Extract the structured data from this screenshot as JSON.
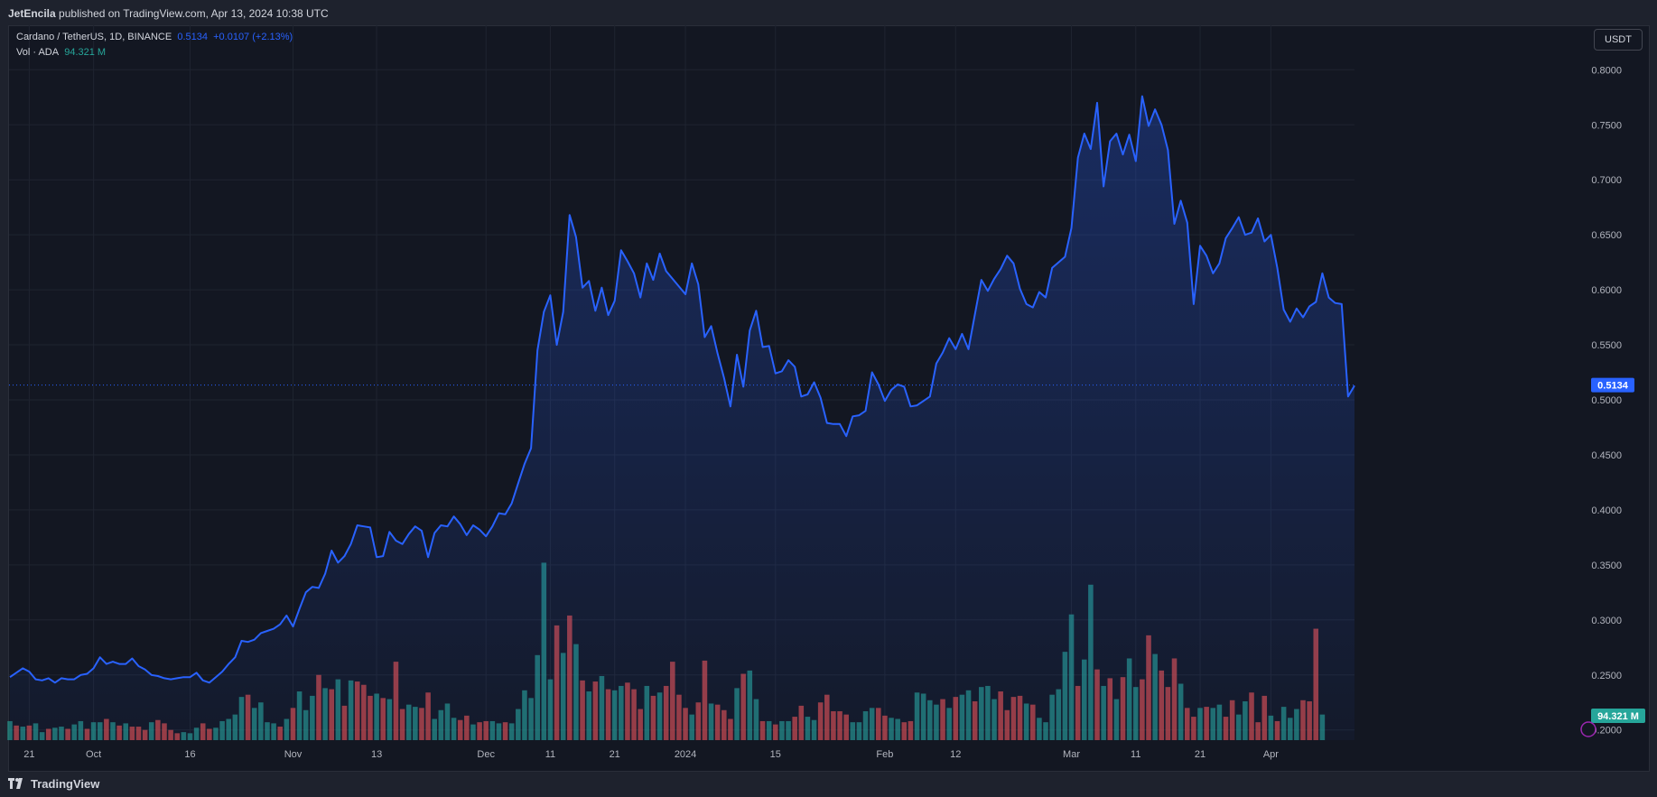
{
  "header": {
    "publisher": "JetEncila",
    "published_text": "published on TradingView.com, Apr 13, 2024 10:38 UTC"
  },
  "legend": {
    "symbol": "Cardano / TetherUS, 1D, BINANCE",
    "last": "0.5134",
    "change": "+0.0107 (+2.13%)",
    "vol_label": "Vol · ADA",
    "vol_value": "94.321 M"
  },
  "currency_button": "USDT",
  "footer": {
    "logo_text": "TradingView"
  },
  "colors": {
    "line": "#2962ff",
    "up_volume": "#26a69a",
    "down_volume": "#ef5350",
    "background": "#131722",
    "grid": "#1f2430"
  },
  "chart_data": {
    "type": "area",
    "title": "Cardano / TetherUS, 1D, BINANCE",
    "ylim": [
      0.19,
      0.82
    ],
    "y_ticks": [
      "0.8000",
      "0.7500",
      "0.7000",
      "0.6500",
      "0.6000",
      "0.5500",
      "0.5000",
      "0.4500",
      "0.4000",
      "0.3500",
      "0.3000",
      "0.2500",
      "0.2000"
    ],
    "x_ticks": [
      {
        "label": "21",
        "index": 3
      },
      {
        "label": "Oct",
        "index": 13
      },
      {
        "label": "16",
        "index": 28
      },
      {
        "label": "Nov",
        "index": 44
      },
      {
        "label": "13",
        "index": 57
      },
      {
        "label": "Dec",
        "index": 74
      },
      {
        "label": "11",
        "index": 84
      },
      {
        "label": "21",
        "index": 94
      },
      {
        "label": "2024",
        "index": 105
      },
      {
        "label": "15",
        "index": 119
      },
      {
        "label": "Feb",
        "index": 136
      },
      {
        "label": "12",
        "index": 147
      },
      {
        "label": "Mar",
        "index": 165
      },
      {
        "label": "11",
        "index": 175
      },
      {
        "label": "21",
        "index": 185
      },
      {
        "label": "Apr",
        "index": 196
      }
    ],
    "last_price_label": "0.5134",
    "last_volume_label": "94.321 M",
    "price": [
      0.248,
      0.252,
      0.256,
      0.253,
      0.246,
      0.245,
      0.247,
      0.243,
      0.247,
      0.246,
      0.246,
      0.25,
      0.251,
      0.256,
      0.266,
      0.26,
      0.262,
      0.26,
      0.26,
      0.265,
      0.258,
      0.255,
      0.25,
      0.249,
      0.247,
      0.246,
      0.247,
      0.248,
      0.248,
      0.252,
      0.245,
      0.243,
      0.248,
      0.253,
      0.26,
      0.266,
      0.281,
      0.28,
      0.282,
      0.288,
      0.29,
      0.292,
      0.296,
      0.304,
      0.294,
      0.31,
      0.325,
      0.33,
      0.329,
      0.342,
      0.363,
      0.352,
      0.358,
      0.369,
      0.386,
      0.385,
      0.384,
      0.357,
      0.358,
      0.38,
      0.372,
      0.369,
      0.378,
      0.385,
      0.381,
      0.357,
      0.379,
      0.386,
      0.385,
      0.394,
      0.387,
      0.377,
      0.386,
      0.382,
      0.376,
      0.385,
      0.397,
      0.396,
      0.406,
      0.424,
      0.442,
      0.456,
      0.545,
      0.58,
      0.595,
      0.55,
      0.58,
      0.668,
      0.648,
      0.602,
      0.608,
      0.581,
      0.602,
      0.577,
      0.59,
      0.636,
      0.626,
      0.615,
      0.593,
      0.624,
      0.609,
      0.633,
      0.617,
      0.61,
      0.603,
      0.596,
      0.624,
      0.605,
      0.557,
      0.567,
      0.542,
      0.52,
      0.494,
      0.541,
      0.512,
      0.563,
      0.581,
      0.548,
      0.549,
      0.524,
      0.526,
      0.536,
      0.53,
      0.503,
      0.505,
      0.516,
      0.502,
      0.479,
      0.478,
      0.478,
      0.467,
      0.485,
      0.486,
      0.49,
      0.525,
      0.514,
      0.499,
      0.509,
      0.514,
      0.512,
      0.494,
      0.495,
      0.499,
      0.503,
      0.533,
      0.543,
      0.556,
      0.546,
      0.56,
      0.546,
      0.578,
      0.609,
      0.599,
      0.61,
      0.619,
      0.631,
      0.624,
      0.601,
      0.587,
      0.584,
      0.598,
      0.593,
      0.62,
      0.625,
      0.63,
      0.656,
      0.72,
      0.742,
      0.728,
      0.77,
      0.694,
      0.735,
      0.742,
      0.723,
      0.741,
      0.717,
      0.776,
      0.749,
      0.764,
      0.75,
      0.727,
      0.66,
      0.681,
      0.661,
      0.587,
      0.64,
      0.631,
      0.615,
      0.624,
      0.647,
      0.656,
      0.666,
      0.65,
      0.652,
      0.665,
      0.644,
      0.65,
      0.62,
      0.582,
      0.571,
      0.583,
      0.575,
      0.585,
      0.589,
      0.615,
      0.593,
      0.588,
      0.587,
      0.503,
      0.513
    ],
    "volume": [
      0.208,
      0.204,
      0.203,
      0.204,
      0.206,
      0.198,
      0.201,
      0.202,
      0.203,
      0.201,
      0.205,
      0.208,
      0.201,
      0.207,
      0.207,
      0.21,
      0.207,
      0.204,
      0.206,
      0.203,
      0.203,
      0.2,
      0.207,
      0.209,
      0.206,
      0.2,
      0.197,
      0.198,
      0.197,
      0.202,
      0.206,
      0.201,
      0.202,
      0.208,
      0.21,
      0.214,
      0.23,
      0.232,
      0.22,
      0.225,
      0.207,
      0.206,
      0.203,
      0.21,
      0.22,
      0.235,
      0.218,
      0.231,
      0.25,
      0.238,
      0.237,
      0.246,
      0.222,
      0.245,
      0.244,
      0.241,
      0.231,
      0.233,
      0.229,
      0.228,
      0.262,
      0.219,
      0.223,
      0.221,
      0.22,
      0.234,
      0.21,
      0.218,
      0.224,
      0.211,
      0.209,
      0.213,
      0.205,
      0.207,
      0.208,
      0.208,
      0.206,
      0.207,
      0.206,
      0.219,
      0.236,
      0.229,
      0.268,
      0.352,
      0.246,
      0.295,
      0.27,
      0.304,
      0.278,
      0.245,
      0.235,
      0.244,
      0.249,
      0.237,
      0.236,
      0.24,
      0.243,
      0.237,
      0.219,
      0.24,
      0.231,
      0.234,
      0.24,
      0.262,
      0.232,
      0.22,
      0.214,
      0.225,
      0.263,
      0.224,
      0.223,
      0.218,
      0.21,
      0.238,
      0.251,
      0.254,
      0.228,
      0.208,
      0.208,
      0.205,
      0.208,
      0.208,
      0.212,
      0.222,
      0.212,
      0.209,
      0.225,
      0.232,
      0.217,
      0.217,
      0.214,
      0.207,
      0.207,
      0.217,
      0.22,
      0.22,
      0.213,
      0.211,
      0.21,
      0.207,
      0.208,
      0.234,
      0.233,
      0.227,
      0.223,
      0.228,
      0.22,
      0.23,
      0.232,
      0.236,
      0.226,
      0.239,
      0.24,
      0.228,
      0.235,
      0.218,
      0.23,
      0.231,
      0.224,
      0.223,
      0.211,
      0.207,
      0.232,
      0.237,
      0.271,
      0.305,
      0.24,
      0.264,
      0.332,
      0.255,
      0.24,
      0.247,
      0.228,
      0.248,
      0.265,
      0.239,
      0.246,
      0.286,
      0.269,
      0.254,
      0.239,
      0.265,
      0.242,
      0.22,
      0.212,
      0.22,
      0.221,
      0.22,
      0.223,
      0.212,
      0.227,
      0.214,
      0.226,
      0.234,
      0.207,
      0.231,
      0.213,
      0.208,
      0.221,
      0.211,
      0.219,
      0.227,
      0.226,
      0.292,
      0.214
    ],
    "volume_up": [
      1,
      0,
      1,
      0,
      1,
      1,
      0,
      1,
      1,
      0,
      1,
      1,
      0,
      1,
      1,
      0,
      1,
      0,
      1,
      0,
      0,
      0,
      1,
      0,
      0,
      0,
      0,
      1,
      1,
      1,
      0,
      0,
      1,
      1,
      1,
      1,
      1,
      0,
      1,
      1,
      1,
      1,
      0,
      1,
      0,
      1,
      1,
      1,
      0,
      1,
      0,
      1,
      0,
      1,
      0,
      0,
      0,
      1,
      0,
      1,
      0,
      0,
      1,
      1,
      0,
      0,
      1,
      1,
      1,
      1,
      0,
      0,
      1,
      0,
      0,
      1,
      1,
      0,
      1,
      1,
      1,
      1,
      1,
      1,
      1,
      0,
      1,
      0,
      1,
      0,
      1,
      0,
      1,
      0,
      1,
      1,
      0,
      0,
      0,
      1,
      0,
      1,
      0,
      0,
      0,
      0,
      1,
      0,
      0,
      1,
      0,
      0,
      0,
      1,
      0,
      1,
      1,
      0,
      1,
      0,
      1,
      1,
      0,
      0,
      1,
      1,
      0,
      0,
      0,
      0,
      0,
      1,
      1,
      1,
      1,
      0,
      0,
      1,
      1,
      0,
      0,
      1,
      1,
      1,
      1,
      0,
      1,
      0,
      1,
      1,
      0,
      1,
      1,
      1,
      0,
      0,
      0,
      0,
      1,
      0,
      1,
      1,
      1,
      1,
      1,
      1,
      0,
      1,
      1,
      0,
      1,
      0,
      1,
      0,
      1,
      1,
      0,
      0,
      1,
      0,
      0,
      0,
      1,
      0,
      0,
      1,
      0,
      1,
      1,
      0,
      0,
      1,
      1,
      0,
      0,
      0,
      1,
      0,
      1,
      1,
      1,
      0,
      0,
      0,
      1
    ]
  }
}
